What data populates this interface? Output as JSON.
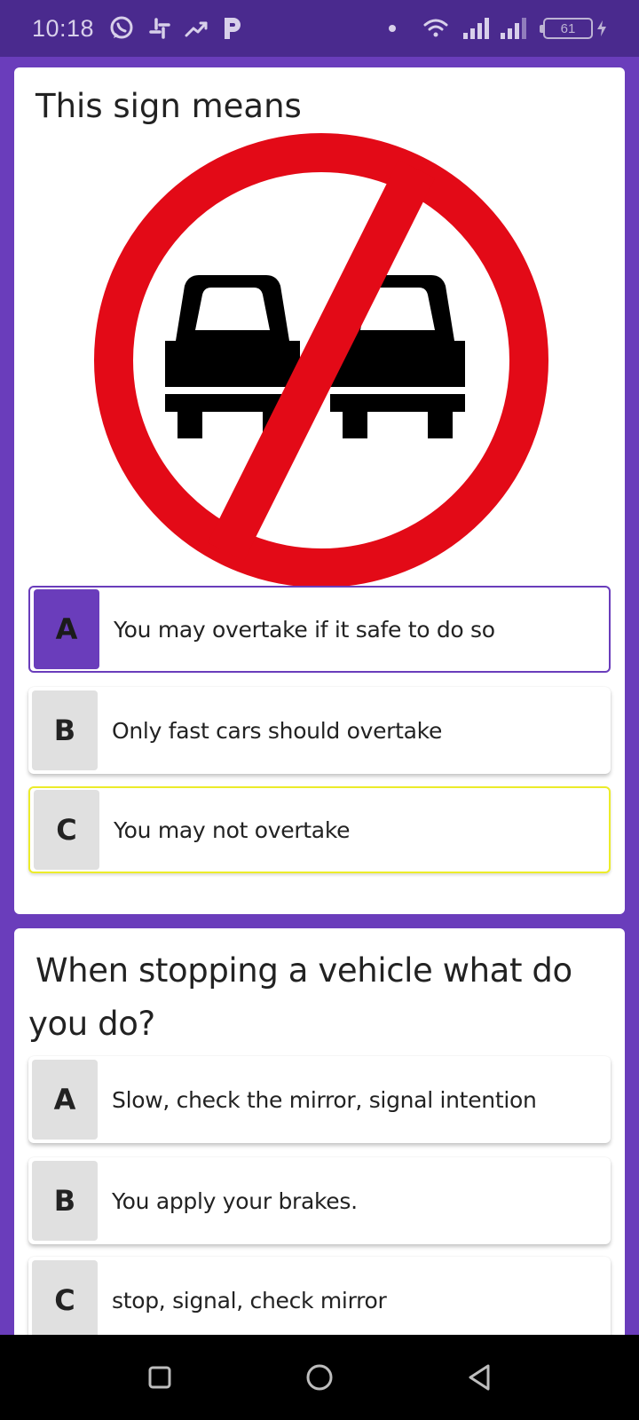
{
  "status_bar": {
    "time": "10:18",
    "battery": "61",
    "icons": [
      "whatsapp-icon",
      "slack-icon",
      "trending-icon",
      "p-app-icon",
      "dot-icon",
      "wifi-icon",
      "signal-icon",
      "signal-icon",
      "battery-icon",
      "charging-icon"
    ]
  },
  "questions": [
    {
      "title": "This sign means",
      "image": "no-overtaking-sign",
      "options": [
        {
          "letter": "A",
          "text": "You may overtake if it safe to do so",
          "state": "selected"
        },
        {
          "letter": "B",
          "text": "Only fast cars should overtake",
          "state": "default"
        },
        {
          "letter": "C",
          "text": "You may not overtake",
          "state": "correct"
        }
      ]
    },
    {
      "title": "When stopping a vehicle what do you do?",
      "options": [
        {
          "letter": "A",
          "text": "Slow, check the mirror, signal intention",
          "state": "default"
        },
        {
          "letter": "B",
          "text": "You apply your brakes.",
          "state": "default"
        },
        {
          "letter": "C",
          "text": "stop, signal, check mirror",
          "state": "default"
        }
      ]
    }
  ],
  "colors": {
    "background": "#6a3dbb",
    "status_bar": "#4a2a8e",
    "selected": "#6a3dbb",
    "correct_border": "#ecec2a",
    "sign_red": "#e30a17"
  },
  "nav_bar": {
    "buttons": [
      "recents-icon",
      "home-icon",
      "back-icon"
    ]
  }
}
